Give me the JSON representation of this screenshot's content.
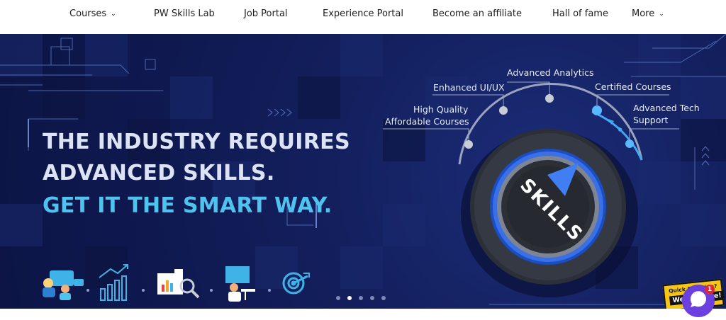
{
  "nav": {
    "items": [
      {
        "label": "Courses",
        "has_dropdown": true
      },
      {
        "label": "PW Skills Lab",
        "has_dropdown": false
      },
      {
        "label": "Job Portal",
        "has_dropdown": false
      },
      {
        "label": "Experience Portal",
        "has_dropdown": false
      },
      {
        "label": "Become an affiliate",
        "has_dropdown": false
      },
      {
        "label": "Hall of fame",
        "has_dropdown": false
      },
      {
        "label": "More",
        "has_dropdown": true
      }
    ],
    "chevron": "⌄"
  },
  "hero": {
    "headline_line1": "THE INDUSTRY REQUIRES",
    "headline_line2": "ADVANCED SKILLS.",
    "headline_line3": "GET IT THE SMART WAY.",
    "dial_text": "SKILLS",
    "skills": [
      {
        "line1": "High Quality",
        "line2": "Affordable Courses"
      },
      {
        "line1": "Enhanced UI/UX",
        "line2": ""
      },
      {
        "line1": "Advanced Analytics",
        "line2": ""
      },
      {
        "line1": "Certified Courses",
        "line2": ""
      },
      {
        "line1": "Advanced Tech",
        "line2": "Support"
      }
    ],
    "feature_icons": [
      "team-meeting-icon",
      "bar-chart-icon",
      "analytics-magnifier-icon",
      "presentation-icon",
      "target-icon"
    ]
  },
  "carousel": {
    "count": 5,
    "active_index": 1
  },
  "chat_widget": {
    "quick_line1": "Quick Question?",
    "quick_line2": "We are here!",
    "badge_count": "1"
  },
  "colors": {
    "hero_bg": "#14205f",
    "headline": "#dbe3f4",
    "accent": "#4fc3ee",
    "chat": "#6c3fe0",
    "badge": "#d9283a",
    "sticker": "#f5c518"
  }
}
